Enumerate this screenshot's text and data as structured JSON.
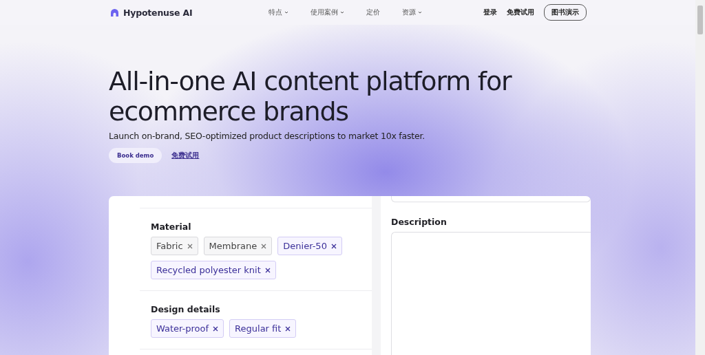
{
  "brand": {
    "name": "Hypotenuse AI"
  },
  "nav": [
    {
      "label": "特点",
      "has_menu": true
    },
    {
      "label": "使用案例",
      "has_menu": true
    },
    {
      "label": "定价",
      "has_menu": false
    },
    {
      "label": "资源",
      "has_menu": true
    }
  ],
  "nav_right": {
    "login": "登录",
    "free_trial": "免费试用",
    "book_demo": "图书演示"
  },
  "hero": {
    "title": "All-in-one AI content platform for ecommerce brands",
    "subtitle": "Launch on-brand, SEO-optimized product descriptions to market 10x faster.",
    "primary_button": "Book demo",
    "secondary_link": "免费试用"
  },
  "form": {
    "sections": [
      {
        "title": "Material",
        "tags": [
          {
            "label": "Fabric",
            "kind": "neutral"
          },
          {
            "label": "Membrane",
            "kind": "neutral"
          },
          {
            "label": "Denier-50",
            "kind": "accent"
          },
          {
            "label": "Recycled polyester knit",
            "kind": "accent"
          }
        ]
      },
      {
        "title": "Design details",
        "tags": [
          {
            "label": "Water-proof",
            "kind": "accent"
          },
          {
            "label": "Regular fit",
            "kind": "accent"
          }
        ]
      }
    ],
    "description_label": "Description"
  }
}
